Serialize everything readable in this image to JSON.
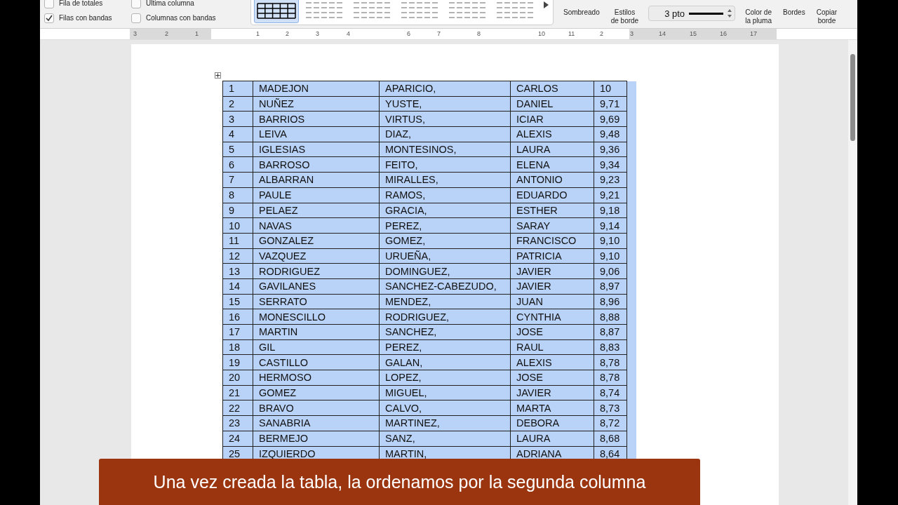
{
  "ribbon": {
    "options": [
      {
        "label": "Fila de totales",
        "checked": false
      },
      {
        "label": "Última columna",
        "checked": false
      },
      {
        "label": "Filas con bandas",
        "checked": true
      },
      {
        "label": "Columnas con bandas",
        "checked": false
      }
    ],
    "styles": [
      {
        "selected": true
      },
      {
        "selected": false
      },
      {
        "selected": false
      },
      {
        "selected": false
      },
      {
        "selected": false
      },
      {
        "selected": false
      }
    ],
    "tools": [
      {
        "kind": "button",
        "label": "Sombreado"
      },
      {
        "kind": "button",
        "label": "Estilos\nde borde"
      },
      {
        "kind": "weight",
        "label": "3 pto"
      },
      {
        "kind": "button",
        "label": "Color de\nla pluma"
      },
      {
        "kind": "button",
        "label": "Bordes"
      },
      {
        "kind": "button",
        "label": "Copiar\nborde"
      }
    ]
  },
  "ruler": {
    "labels": [
      "3",
      "2",
      "1",
      "1",
      "2",
      "3",
      "4",
      "6",
      "7",
      "8",
      "10",
      "11",
      "2",
      "3",
      "14",
      "15",
      "16",
      "17"
    ]
  },
  "table": {
    "rows": [
      {
        "cells": [
          "1",
          "MADEJON",
          "APARICIO,",
          "CARLOS",
          "10"
        ],
        "selected": true
      },
      {
        "cells": [
          "2",
          "NUÑEZ",
          "YUSTE,",
          "DANIEL",
          "9,71"
        ],
        "selected": true
      },
      {
        "cells": [
          "3",
          "BARRIOS",
          "VIRTUS,",
          "ICIAR",
          "9,69"
        ],
        "selected": true
      },
      {
        "cells": [
          "4",
          "LEIVA",
          "DIAZ,",
          "ALEXIS",
          "9,48"
        ],
        "selected": true
      },
      {
        "cells": [
          "5",
          "IGLESIAS",
          "MONTESINOS,",
          "LAURA",
          "9,36"
        ],
        "selected": true
      },
      {
        "cells": [
          "6",
          "BARROSO",
          "FEITO,",
          "ELENA",
          "9,34"
        ],
        "selected": true
      },
      {
        "cells": [
          "7",
          "ALBARRAN",
          "MIRALLES,",
          "ANTONIO",
          "9,23"
        ],
        "selected": true
      },
      {
        "cells": [
          "8",
          "PAULE",
          "RAMOS,",
          "EDUARDO",
          "9,21"
        ],
        "selected": true
      },
      {
        "cells": [
          "9",
          "PELAEZ",
          "GRACIA,",
          "ESTHER",
          "9,18"
        ],
        "selected": true
      },
      {
        "cells": [
          "10",
          "NAVAS",
          "PEREZ,",
          "SARAY",
          "9,14"
        ],
        "selected": true
      },
      {
        "cells": [
          "11",
          "GONZALEZ",
          "GOMEZ,",
          "FRANCISCO",
          "9,10"
        ],
        "selected": true
      },
      {
        "cells": [
          "12",
          "VAZQUEZ",
          "URUEÑA,",
          "PATRICIA",
          "9,10"
        ],
        "selected": true
      },
      {
        "cells": [
          "13",
          "RODRIGUEZ",
          "DOMINGUEZ,",
          "JAVIER",
          "9,06"
        ],
        "selected": true
      },
      {
        "cells": [
          "14",
          "GAVILANES",
          "SANCHEZ-CABEZUDO,",
          "JAVIER",
          "8,97"
        ],
        "selected": true
      },
      {
        "cells": [
          "15",
          "SERRATO",
          "MENDEZ,",
          "JUAN",
          "8,96"
        ],
        "selected": true
      },
      {
        "cells": [
          "16",
          "MONESCILLO",
          "RODRIGUEZ,",
          "CYNTHIA",
          "8,88"
        ],
        "selected": true
      },
      {
        "cells": [
          "17",
          "MARTIN",
          "SANCHEZ,",
          "JOSE",
          "8,87"
        ],
        "selected": true
      },
      {
        "cells": [
          "18",
          "GIL",
          "PEREZ,",
          "RAUL",
          "8,83"
        ],
        "selected": true
      },
      {
        "cells": [
          "19",
          "CASTILLO",
          "GALAN,",
          "ALEXIS",
          "8,78"
        ],
        "selected": true
      },
      {
        "cells": [
          "20",
          "HERMOSO",
          "LOPEZ,",
          "JOSE",
          "8,78"
        ],
        "selected": true
      },
      {
        "cells": [
          "21",
          "GOMEZ",
          "MIGUEL,",
          "JAVIER",
          "8,74"
        ],
        "selected": true
      },
      {
        "cells": [
          "22",
          "BRAVO",
          "CALVO,",
          "MARTA",
          "8,73"
        ],
        "selected": true
      },
      {
        "cells": [
          "23",
          "SANABRIA",
          "MARTINEZ,",
          "DEBORA",
          "8,72"
        ],
        "selected": true
      },
      {
        "cells": [
          "24",
          "BERMEJO",
          "SANZ,",
          "LAURA",
          "8,68"
        ],
        "selected": true
      },
      {
        "cells": [
          "25",
          "IZQUIERDO",
          "MARTIN,",
          "ADRIANA",
          "8,64"
        ],
        "selected": true
      }
    ]
  },
  "caption": "Una vez creada la tabla, la ordenamos por la segunda columna"
}
